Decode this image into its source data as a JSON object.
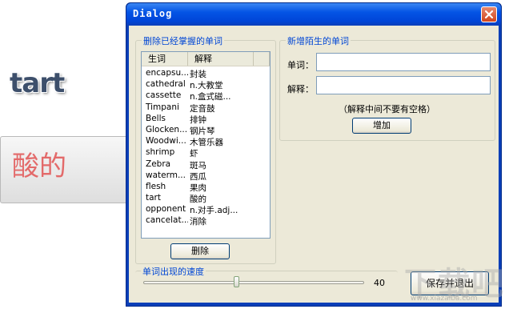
{
  "background": {
    "word": "tart",
    "meaning": "酸的"
  },
  "dialog": {
    "title": "Dialog",
    "delete_group": {
      "title": "删除已经掌握的单词",
      "columns": [
        "生词",
        "解释"
      ],
      "rows": [
        {
          "word": "encapsu...",
          "meaning": "封装"
        },
        {
          "word": "cathedral",
          "meaning": "n.大教堂"
        },
        {
          "word": "cassette",
          "meaning": "n.盒式磁..."
        },
        {
          "word": "Timpani",
          "meaning": "定音鼓"
        },
        {
          "word": "Bells",
          "meaning": "排钟"
        },
        {
          "word": "Glocken...",
          "meaning": "钢片琴"
        },
        {
          "word": "Woodwi...",
          "meaning": "木管乐器"
        },
        {
          "word": "shrimp",
          "meaning": "虾"
        },
        {
          "word": "Zebra",
          "meaning": "斑马"
        },
        {
          "word": "waterm...",
          "meaning": "西瓜"
        },
        {
          "word": "flesh",
          "meaning": "果肉"
        },
        {
          "word": "tart",
          "meaning": "酸的"
        },
        {
          "word": "opponent",
          "meaning": "n.对手.adj..."
        },
        {
          "word": "cancelat...",
          "meaning": "消除"
        }
      ],
      "delete_button": "删除"
    },
    "add_group": {
      "title": "新增陌生的单词",
      "word_label": "单词：",
      "word_value": "",
      "meaning_label": "解释：",
      "meaning_value": "",
      "hint": "（解释中间不要有空格）",
      "add_button": "增加"
    },
    "speed_group": {
      "title": "单词出现的速度",
      "value": "40",
      "slider_fraction": 0.42
    },
    "save_exit_button": "保存并退出"
  },
  "watermark": {
    "text": "下载吧",
    "url": "www.xiazaiba.com"
  },
  "colors": {
    "title_blue": "#0454e5",
    "group_title": "#0046d5",
    "close_red": "#d1451d"
  }
}
